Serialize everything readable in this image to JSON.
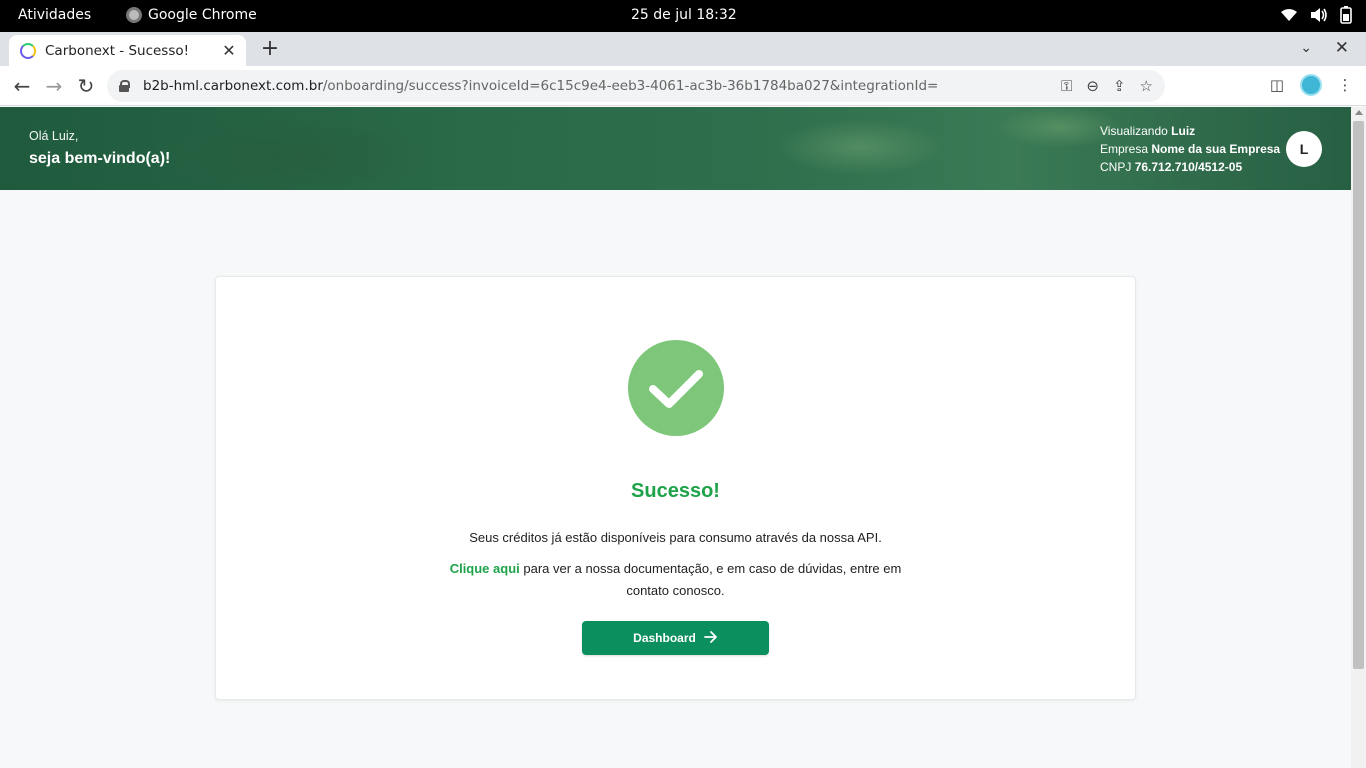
{
  "system": {
    "activities": "Atividades",
    "app_name": "Google Chrome",
    "clock": "25 de jul  18:32",
    "tray_icons": [
      "wifi-icon",
      "volume-icon",
      "battery-icon"
    ]
  },
  "browser": {
    "tab_title": "Carbonext - Sucesso!",
    "url_host": "b2b-hml.carbonext.com.br",
    "url_path": "/onboarding/success?invoiceId=6c15c9e4-eeb3-4061-ac3b-36b1784ba027&integrationId=",
    "toolbar_icons": [
      "key-icon",
      "zoom-icon",
      "share-icon",
      "star-icon",
      "side-panel-icon",
      "profile-icon",
      "menu-icon"
    ]
  },
  "header": {
    "greeting": "Olá Luiz,",
    "welcome": "seja bem-vindo(a)!",
    "viewing_label": "Visualizando",
    "viewing_user": "Luiz",
    "company_label": "Empresa",
    "company_name": "Nome da sua Empresa",
    "cnpj_label": "CNPJ",
    "cnpj_value": "76.712.710/4512-05",
    "avatar_letter": "L"
  },
  "card": {
    "heading": "Sucesso!",
    "message": "Seus créditos já estão disponíveis para consumo através da nossa API.",
    "link_text": "Clique aqui",
    "message_after_link": " para ver a nossa documentação, e em caso de dúvidas, entre em contato conosco.",
    "button_label": "Dashboard"
  },
  "colors": {
    "accent_green": "#1ea34a",
    "button_green": "#0c8f5e",
    "check_circle": "#7ec77a"
  }
}
